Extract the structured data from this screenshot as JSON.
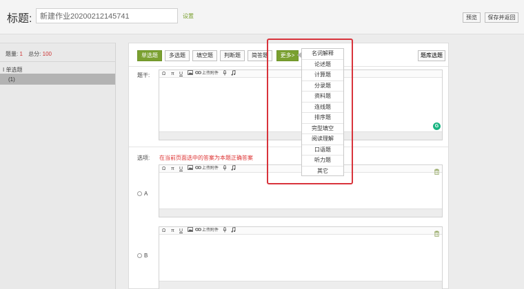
{
  "header": {
    "title_label": "标题:",
    "title_value": "新建作业20200212145741",
    "setting_link": "设置",
    "preview_label": "预览",
    "save_return_label": "保存并返回"
  },
  "sidebar": {
    "count_label": "题量:",
    "count_value": "1",
    "score_label": "总分:",
    "score_value": "100",
    "group_label": "I 单选题",
    "item_label": "(1)"
  },
  "types": {
    "tabs": [
      "单选题",
      "多选题",
      "填空题",
      "判断题",
      "简答题"
    ],
    "more_label": "更多>",
    "bank_label": "题库选题"
  },
  "dropdown": {
    "items": [
      "名词解释",
      "论述题",
      "计算题",
      "分录题",
      "资料题",
      "连线题",
      "排序题",
      "完型填空",
      "阅读理解",
      "口语题",
      "听力题",
      "其它"
    ]
  },
  "editor": {
    "stem_label": "题干:",
    "options_label": "选项:",
    "hint": "在当前页面选中的答案为本题正确答案",
    "toolbar": {
      "omega": "Ω",
      "pi": "π",
      "underline": "U",
      "attach_label": "上传附件"
    },
    "options": [
      {
        "letter": "A"
      },
      {
        "letter": "B"
      }
    ]
  },
  "colors": {
    "accent_green": "#7aa030",
    "hint_red": "#d33333",
    "highlight_red": "#d8323a"
  }
}
